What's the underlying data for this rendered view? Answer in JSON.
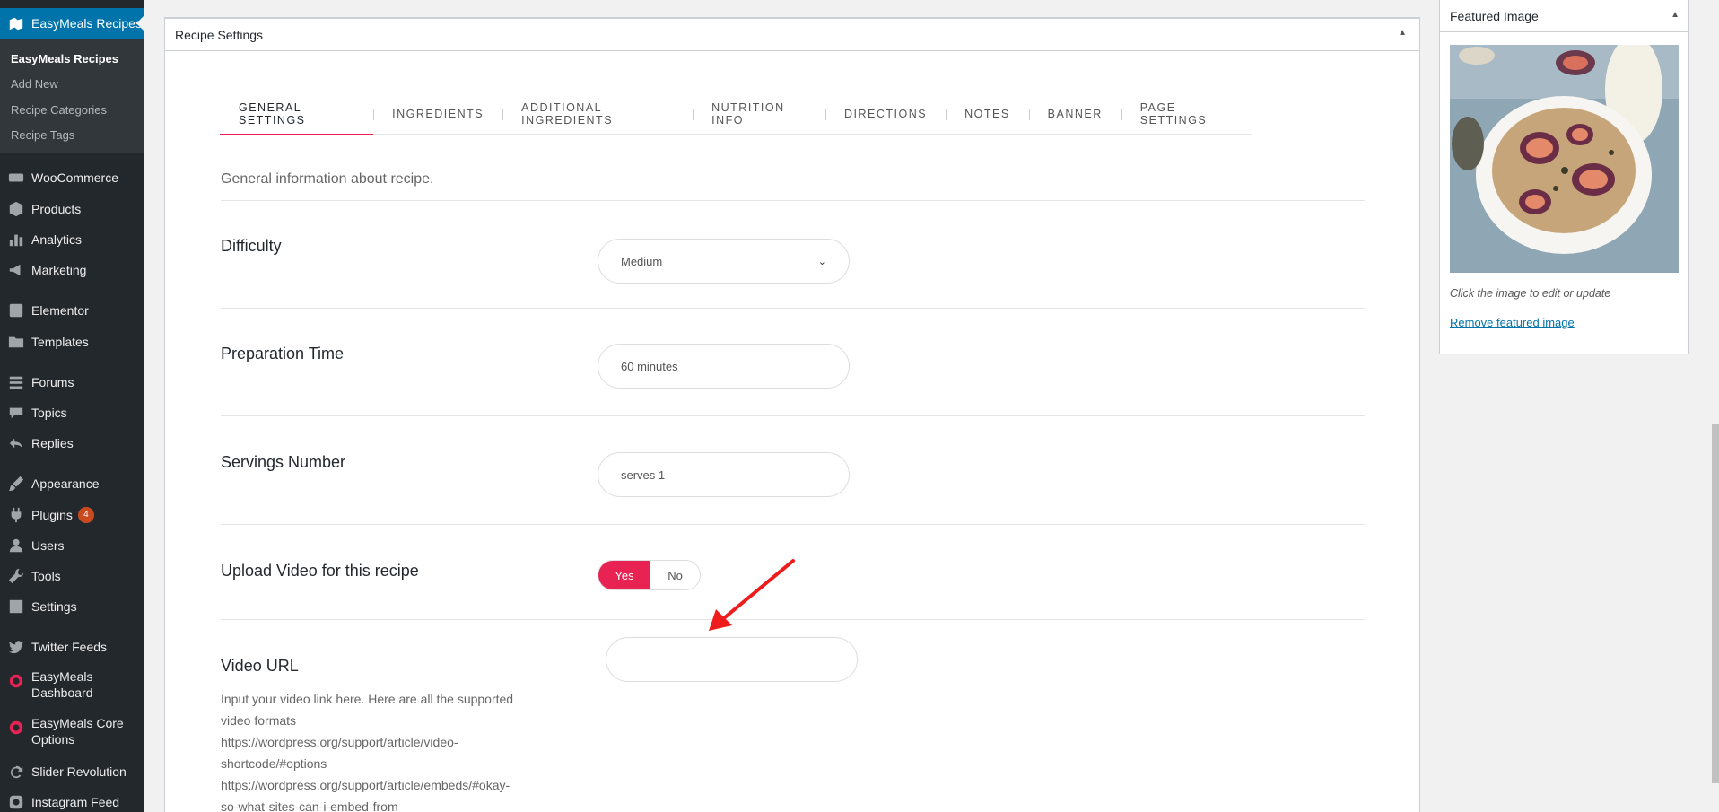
{
  "sidebar": {
    "active": {
      "label": "EasyMeals Recipes",
      "icon": "recipe-icon"
    },
    "submenu": [
      "EasyMeals Recipes",
      "Add New",
      "Recipe Categories",
      "Recipe Tags"
    ],
    "items": [
      {
        "label": "WooCommerce",
        "icon": "woocommerce-icon"
      },
      {
        "label": "Products",
        "icon": "products-icon"
      },
      {
        "label": "Analytics",
        "icon": "analytics-icon"
      },
      {
        "label": "Marketing",
        "icon": "megaphone-icon"
      },
      {
        "label": "Elementor",
        "icon": "elementor-icon"
      },
      {
        "label": "Templates",
        "icon": "folder-icon"
      },
      {
        "label": "Forums",
        "icon": "forums-icon"
      },
      {
        "label": "Topics",
        "icon": "topics-icon"
      },
      {
        "label": "Replies",
        "icon": "replies-icon"
      },
      {
        "label": "Appearance",
        "icon": "brush-icon"
      },
      {
        "label": "Plugins",
        "icon": "plugin-icon",
        "badge": "4"
      },
      {
        "label": "Users",
        "icon": "user-icon"
      },
      {
        "label": "Tools",
        "icon": "wrench-icon"
      },
      {
        "label": "Settings",
        "icon": "settings-icon"
      },
      {
        "label": "Twitter Feeds",
        "icon": "twitter-icon"
      },
      {
        "label": "EasyMeals Dashboard",
        "icon": "easymeals-icon"
      },
      {
        "label": "EasyMeals Core Options",
        "icon": "easymeals-icon"
      },
      {
        "label": "Slider Revolution",
        "icon": "refresh-icon"
      },
      {
        "label": "Instagram Feed",
        "icon": "instagram-icon"
      }
    ]
  },
  "metabox": {
    "title": "Recipe Settings",
    "tabs": [
      "GENERAL SETTINGS",
      "INGREDIENTS",
      "ADDITIONAL INGREDIENTS",
      "NUTRITION INFO",
      "DIRECTIONS",
      "NOTES",
      "BANNER",
      "PAGE SETTINGS"
    ],
    "active_tab": "GENERAL SETTINGS",
    "intro": "General information about recipe.",
    "fields": {
      "difficulty": {
        "label": "Difficulty",
        "value": "Medium"
      },
      "prep_time": {
        "label": "Preparation Time",
        "value": "60 minutes"
      },
      "servings": {
        "label": "Servings Number",
        "value": "serves 1"
      },
      "video_toggle": {
        "label": "Upload Video for this recipe",
        "yes": "Yes",
        "no": "No",
        "selected": "Yes"
      },
      "video_url": {
        "label": "Video URL",
        "value": "",
        "help": [
          "Input your video link here. Here are all the supported",
          "video formats",
          "https://wordpress.org/support/article/video-",
          "shortcode/#options",
          "https://wordpress.org/support/article/embeds/#okay-",
          "so-what-sites-can-i-embed-from"
        ]
      }
    }
  },
  "featured_image": {
    "title": "Featured Image",
    "note": "Click the image to edit or update",
    "remove_link": "Remove featured image"
  },
  "colors": {
    "accent": "#e82253",
    "sidebar_bg": "#23282d",
    "sidebar_active": "#0073aa",
    "link": "#0073aa"
  }
}
